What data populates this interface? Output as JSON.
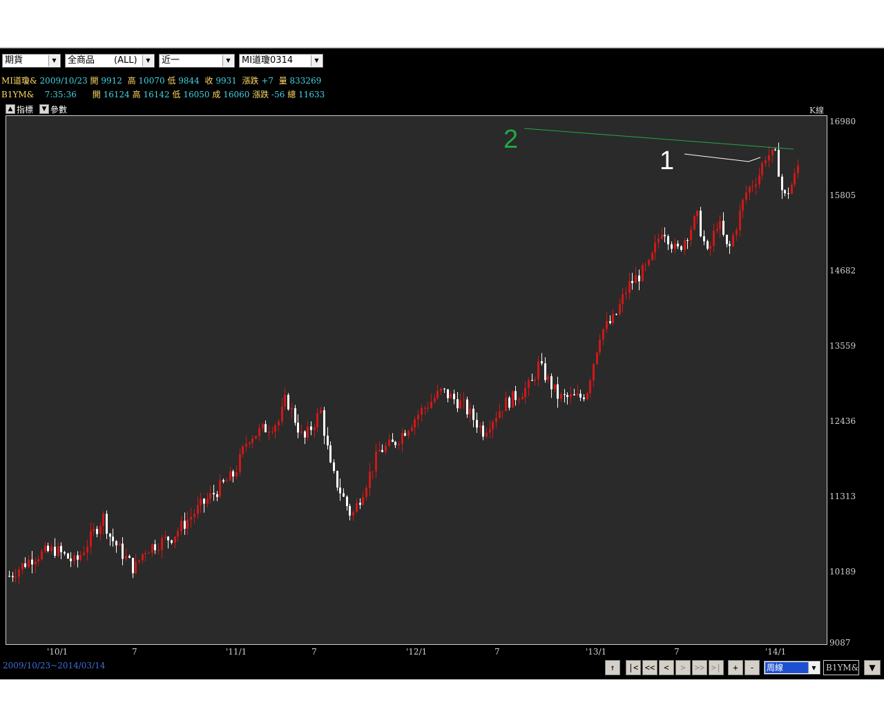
{
  "toolbar": {
    "market": "期貨",
    "product": "全商品",
    "product_scope": "(ALL)",
    "period": "近一",
    "contract": "MI道瓊0314"
  },
  "quote1": {
    "name": "MI道瓊&",
    "date": "2009/10/23",
    "open_label": "開",
    "open": "9912",
    "high_label": "高",
    "high": "10070",
    "low_label": "低",
    "low": "9844",
    "close_label": "收",
    "close": "9931",
    "change_label": "漲跌",
    "change": "+7",
    "volume_label": "量",
    "volume": "833269"
  },
  "quote2": {
    "name": "B1YM&",
    "time": "7:35:36",
    "open_label": "開",
    "open": "16124",
    "high_label": "高",
    "high": "16142",
    "low_label": "低",
    "low": "16050",
    "last_label": "成",
    "last": "16060",
    "change_label": "漲跌",
    "change": "-56",
    "total_label": "總",
    "total": "11633"
  },
  "chart_tools": {
    "indicators": "指標",
    "params": "參數",
    "chart_kind": "K線"
  },
  "chart_data": {
    "type": "candlestick",
    "y_ticks": [
      "16980",
      "15805",
      "14682",
      "13559",
      "12436",
      "11313",
      "10189",
      "9087"
    ],
    "ylim": [
      9087,
      16980
    ],
    "x_ticks": [
      "'10/1",
      "7",
      "'11/1",
      "7",
      "'12/1",
      "7",
      "'13/1",
      "7",
      "'14/1"
    ],
    "annotations": [
      {
        "label": "1",
        "color": "#ffffff"
      },
      {
        "label": "2",
        "color": "#22aa44"
      }
    ],
    "colors": {
      "up": "#d01818",
      "down": "#ffffff",
      "trendline": "#22aa44"
    }
  },
  "footer": {
    "date_range": "2009/10/23~2014/03/14",
    "buttons": [
      "↑",
      "|<",
      "<<",
      "<",
      ">",
      ">>",
      ">|",
      "+",
      "-"
    ],
    "selected_type": "周線",
    "symbol": "B1YM&",
    "dropdown": "▼"
  }
}
